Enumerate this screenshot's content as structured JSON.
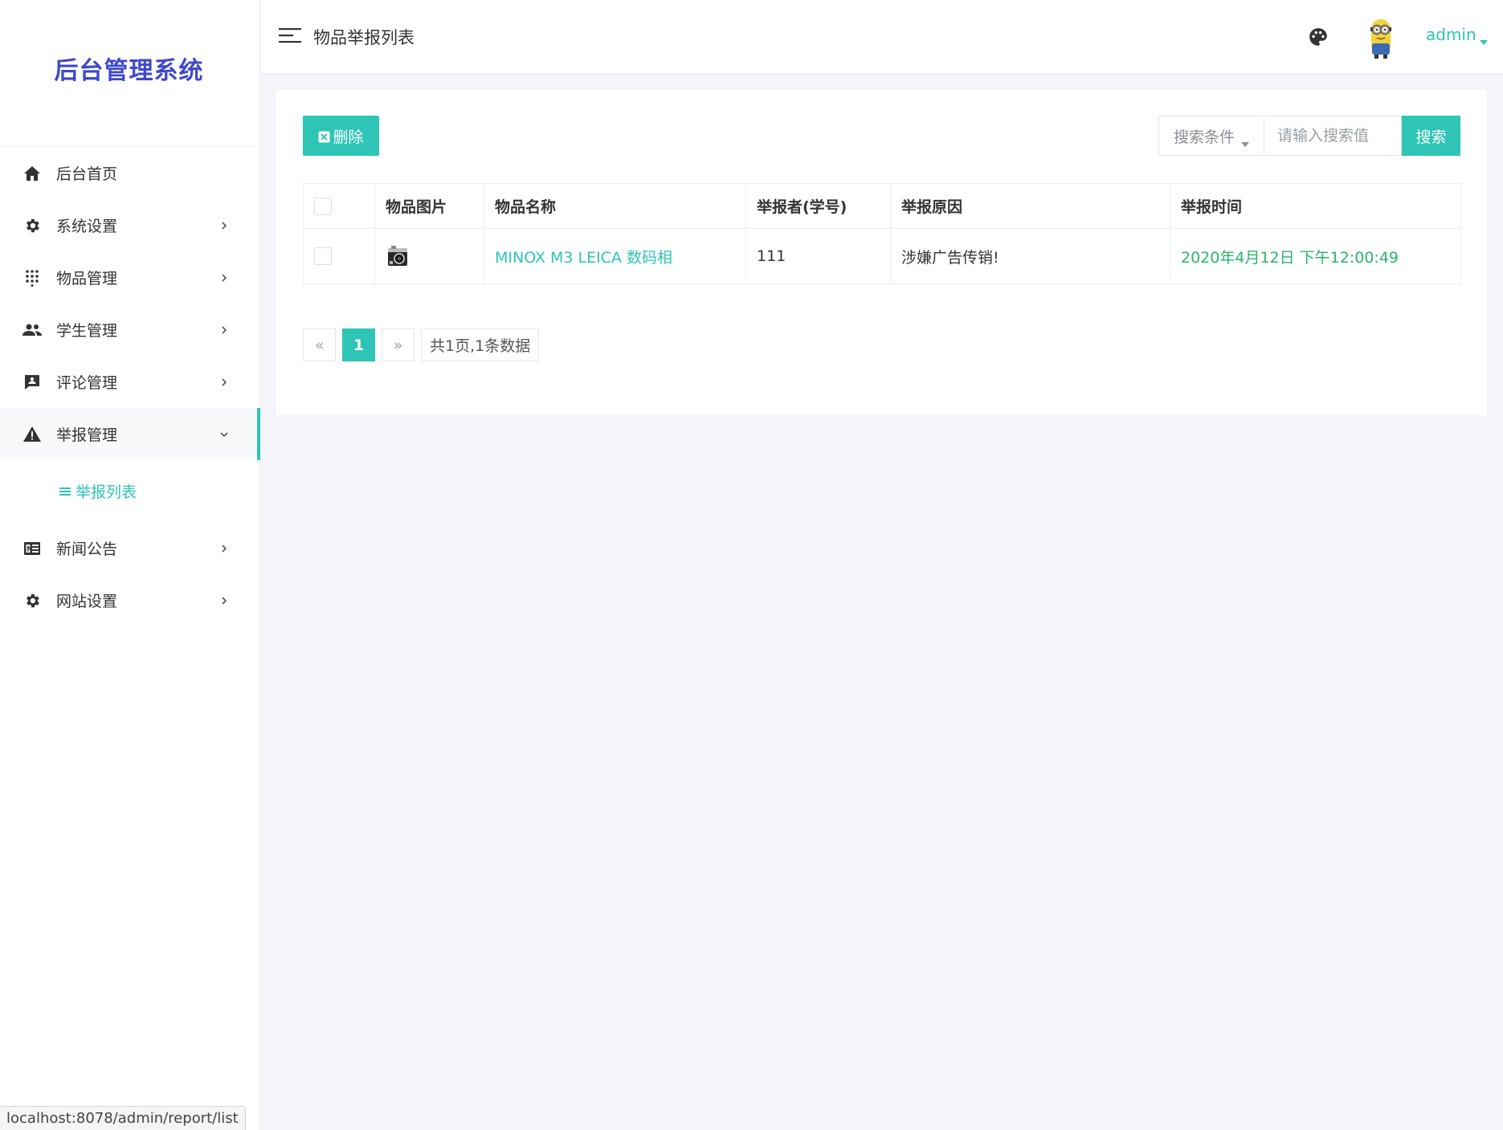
{
  "brand": {
    "title": "后台管理系统"
  },
  "sidebar": {
    "items": [
      {
        "label": "后台首页",
        "icon": "home-icon"
      },
      {
        "label": "系统设置",
        "icon": "gear-icon"
      },
      {
        "label": "物品管理",
        "icon": "grid-dots-icon"
      },
      {
        "label": "学生管理",
        "icon": "users-icon"
      },
      {
        "label": "评论管理",
        "icon": "comment-icon"
      },
      {
        "label": "举报管理",
        "icon": "warning-icon"
      },
      {
        "label": "新闻公告",
        "icon": "news-icon"
      },
      {
        "label": "网站设置",
        "icon": "gear-icon"
      }
    ],
    "active_item": "举报管理",
    "submenu": {
      "label": "举报列表",
      "icon": "list-icon"
    }
  },
  "header": {
    "title": "物品举报列表",
    "user_name": "admin"
  },
  "toolbar": {
    "delete_label": "删除",
    "search_dropdown_label": "搜索条件",
    "search_placeholder": "请输入搜索值",
    "search_value": "",
    "search_button_label": "搜索"
  },
  "table": {
    "headers": [
      "物品图片",
      "物品名称",
      "举报者(学号)",
      "举报原因",
      "举报时间"
    ],
    "rows": [
      {
        "image_icon": "camera-icon",
        "name": "MINOX M3 LEICA 数码相",
        "reporter": "111",
        "reason": "涉嫌广告传销!",
        "time": "2020年4月12日 下午12:00:49"
      }
    ]
  },
  "pagination": {
    "prev": "«",
    "current": "1",
    "next": "»",
    "info": "共1页,1条数据"
  },
  "statusbar": {
    "url": "localhost:8078/admin/report/list"
  },
  "colors": {
    "accent": "#2ec5b6",
    "brand": "#3f48cc",
    "time_green": "#2bb56a"
  }
}
